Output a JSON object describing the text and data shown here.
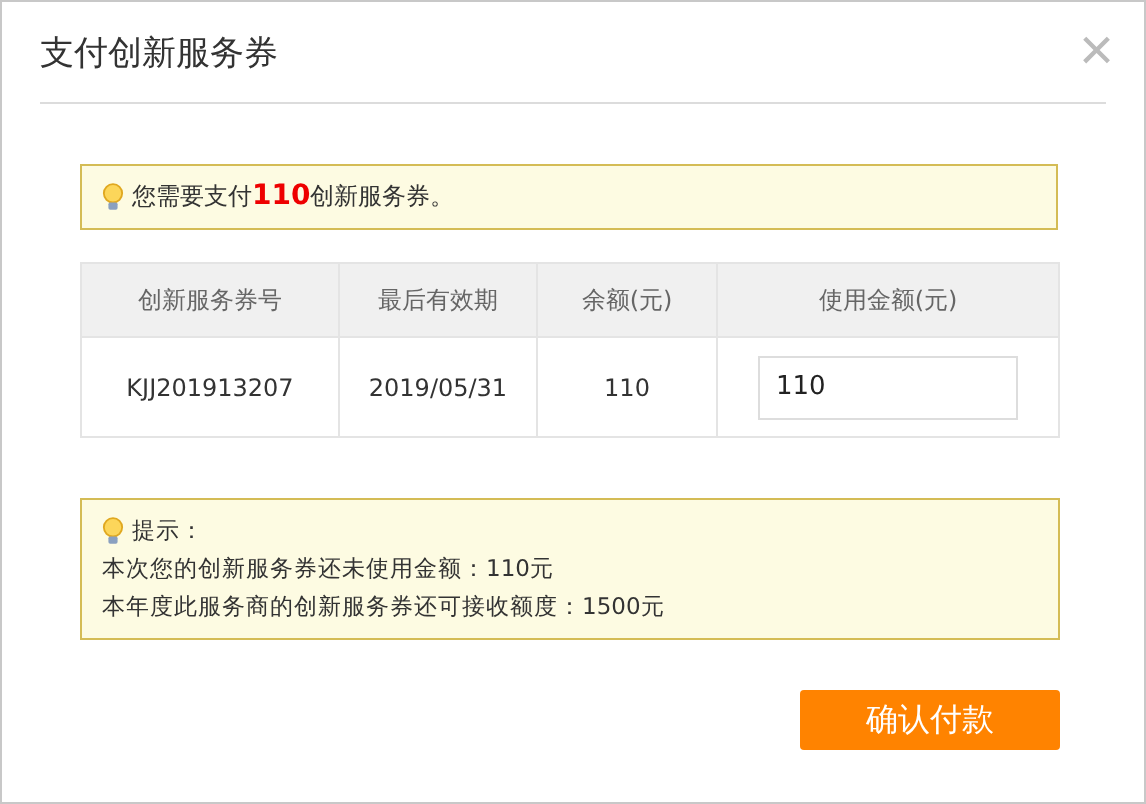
{
  "dialog": {
    "title": "支付创新服务券",
    "close": "×"
  },
  "notice": {
    "text": "您需要支付**110**创新服务券。"
  },
  "table": {
    "columns": [
      "创新服务券号",
      "最后有效期",
      "余额(元)",
      "使用金额(元)"
    ],
    "rows": [
      {
        "cells": [
          "KJJ201913207",
          "2019/05/31",
          "110"
        ],
        "amount": "110"
      }
    ]
  },
  "tip": {
    "heading": "提示：",
    "lines": [
      "本次您的创新服务券还未使用金额：110元",
      "本年度此服务商的创新服务券还可接收额度：1500元"
    ]
  },
  "buttons": [
    "确认付款"
  ]
}
